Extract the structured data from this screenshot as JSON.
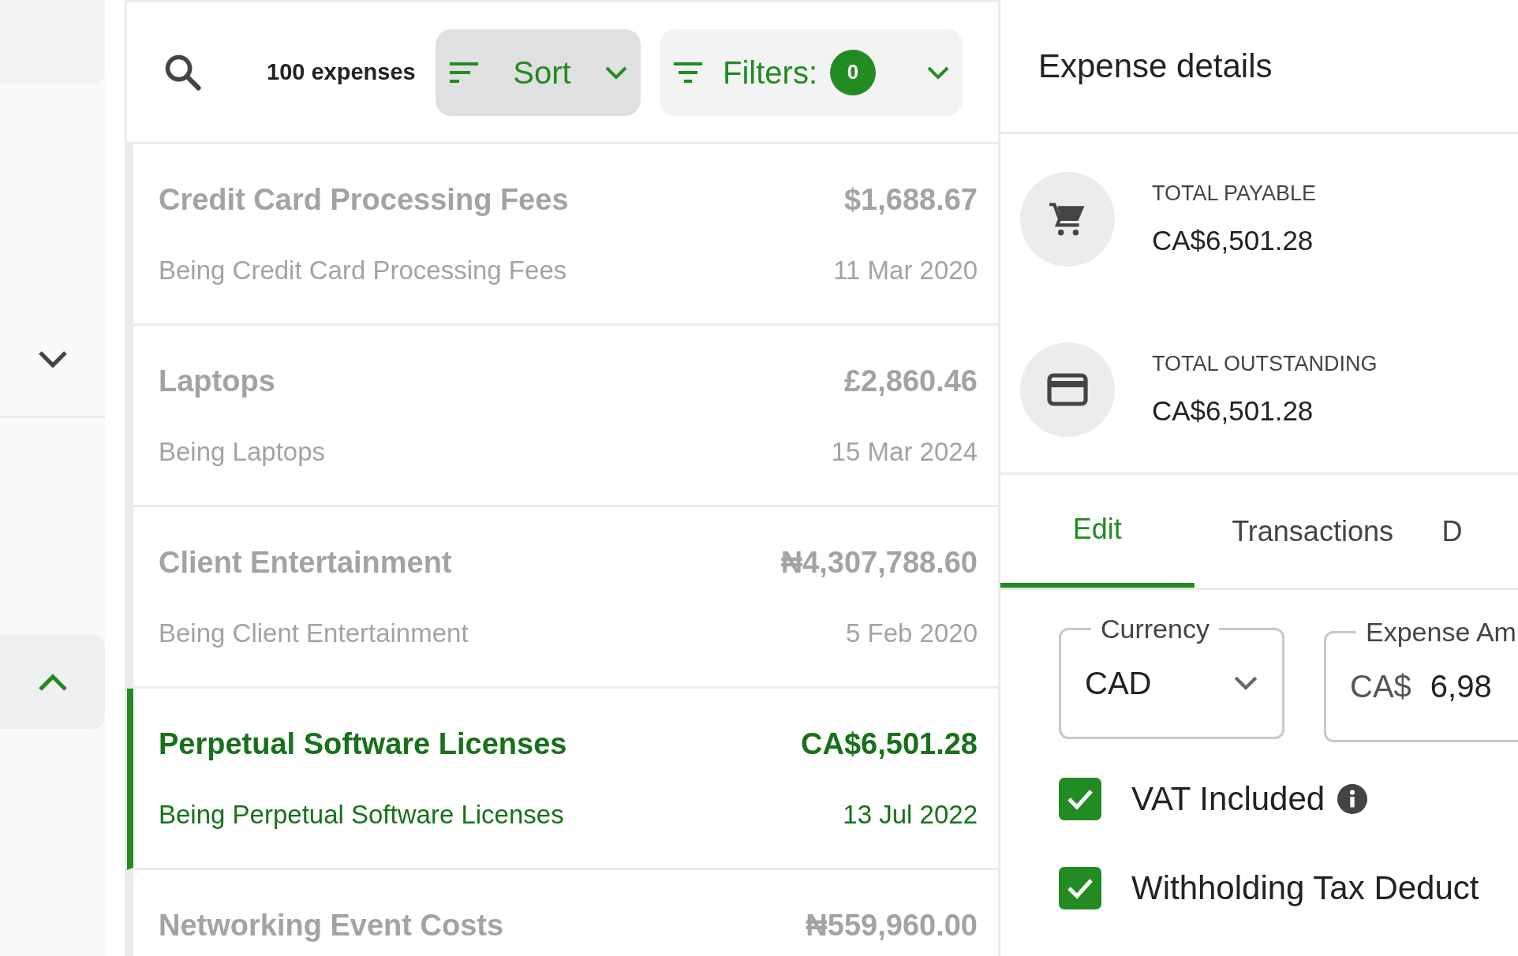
{
  "sidebar": {
    "groups": [
      {
        "expanded": false,
        "selected": false
      },
      {
        "expanded": true,
        "selected": true
      }
    ]
  },
  "list": {
    "count": "100 expenses",
    "sort": {
      "label": "Sort",
      "active": true
    },
    "filters": {
      "label": "Filters:",
      "count": "0",
      "active": false
    },
    "expenses": [
      {
        "name": "Credit Card Processing Fees",
        "amount": "$1,688.67",
        "description": "Being Credit Card Processing Fees",
        "date": "11 Mar 2020",
        "selected": false
      },
      {
        "name": "Laptops",
        "amount": "£2,860.46",
        "description": "Being Laptops",
        "date": "15 Mar 2024",
        "selected": false
      },
      {
        "name": "Client Entertainment",
        "amount": "₦4,307,788.60",
        "description": "Being Client Entertainment",
        "date": "5 Feb 2020",
        "selected": false
      },
      {
        "name": "Perpetual Software Licenses",
        "amount": "CA$6,501.28",
        "description": "Being Perpetual Software Licenses",
        "date": "13 Jul 2022",
        "selected": true
      },
      {
        "name": "Networking Event Costs",
        "amount": "₦559,960.00",
        "selected": false
      }
    ]
  },
  "details": {
    "title": "Expense details",
    "totals": [
      {
        "kind": "cart",
        "label": "TOTAL PAYABLE",
        "amount": "CA$6,501.28"
      },
      {
        "kind": "card",
        "label": "TOTAL OUTSTANDING",
        "amount": "CA$6,501.28"
      }
    ],
    "tabs": [
      {
        "label": "Edit",
        "selected": true
      },
      {
        "label": "Transactions",
        "selected": false
      },
      {
        "label": "D",
        "selected": false
      }
    ],
    "form": {
      "currency": {
        "label": "Currency",
        "value": "CAD"
      },
      "amount": {
        "label": "Expense Am",
        "prefix": "CA$",
        "value": "6,98"
      },
      "checkboxes": [
        {
          "label": "VAT Included",
          "checked": true,
          "info": true
        },
        {
          "label": "Withholding Tax Deduct",
          "checked": true,
          "info": false
        }
      ]
    }
  }
}
